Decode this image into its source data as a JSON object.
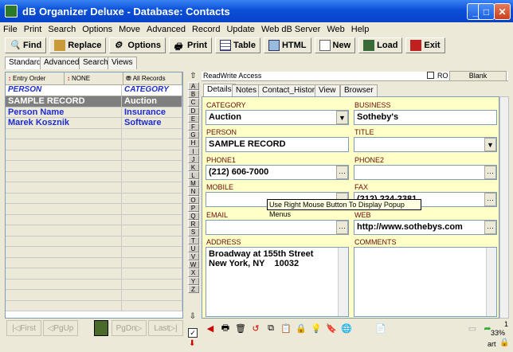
{
  "window": {
    "title": "dB Organizer Deluxe - Database: Contacts"
  },
  "menu": [
    "File",
    "Print",
    "Search",
    "Options",
    "Move",
    "Advanced",
    "Record",
    "Update",
    "Web dB Server",
    "Web",
    "Help"
  ],
  "toolbar": {
    "find": "Find",
    "replace": "Replace",
    "options": "Options",
    "print": "Print",
    "table": "Table",
    "html": "HTML",
    "new": "New",
    "load": "Load",
    "exit": "Exit"
  },
  "left_tabs": [
    "Standard",
    "Advanced",
    "Search",
    "Views"
  ],
  "sort": {
    "entry_order": "Entry Order",
    "none": "NONE",
    "all_records": "All Records"
  },
  "list": {
    "headers": [
      "PERSON",
      "CATEGORY"
    ],
    "rows": [
      [
        "SAMPLE RECORD",
        "Auction"
      ],
      [
        "Person Name",
        "Insurance"
      ],
      [
        "Marek Kosznik",
        "Software"
      ]
    ]
  },
  "nav": {
    "first": "First",
    "pgup": "PgUp",
    "pgdn": "PgDn",
    "last": "Last"
  },
  "access": {
    "text": "ReadWrite Access",
    "ro": "RO",
    "blank": "Blank"
  },
  "detail_tabs": [
    "Details",
    "Notes",
    "Contact_History",
    "View",
    "Browser"
  ],
  "alphabet": [
    "A",
    "B",
    "C",
    "D",
    "E",
    "F",
    "G",
    "H",
    "I",
    "J",
    "K",
    "L",
    "M",
    "N",
    "O",
    "P",
    "Q",
    "R",
    "S",
    "T",
    "U",
    "V",
    "W",
    "X",
    "Y",
    "Z"
  ],
  "fields": {
    "category": {
      "label": "CATEGORY",
      "value": "Auction"
    },
    "business": {
      "label": "BUSINESS",
      "value": "Sotheby's"
    },
    "person": {
      "label": "PERSON",
      "value": "SAMPLE RECORD"
    },
    "title": {
      "label": "TITLE",
      "value": ""
    },
    "phone1": {
      "label": "PHONE1",
      "value": "(212) 606-7000"
    },
    "phone2": {
      "label": "PHONE2",
      "value": ""
    },
    "mobile": {
      "label": "MOBILE",
      "value": ""
    },
    "fax": {
      "label": "FAX",
      "value": "(212) 224-2381"
    },
    "email": {
      "label": "EMAIL",
      "value": ""
    },
    "web": {
      "label": "WEB",
      "value": "http://www.sothebys.com"
    },
    "address": {
      "label": "ADDRESS",
      "line1": "Broadway at 155th Street",
      "line2": "New York, NY    10032"
    },
    "comments": {
      "label": "COMMENTS",
      "value": ""
    }
  },
  "tooltip": "Use Right Mouse Button To Display Popup Menus",
  "status": {
    "page": "1",
    "zoom": "33%",
    "user": "art"
  },
  "colors": {
    "titlebar": "#0a4fd8",
    "form_bg": "#ffffc8",
    "list_text": "#1c2bd2",
    "label_text": "#6a0a0a"
  }
}
